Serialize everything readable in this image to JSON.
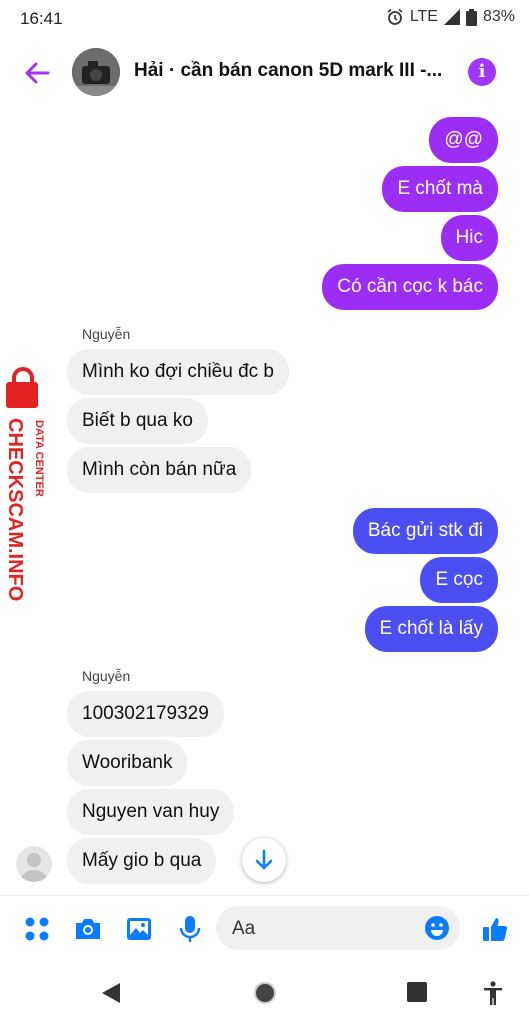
{
  "status": {
    "time": "16:41",
    "network": "LTE",
    "battery": "83%"
  },
  "header": {
    "title": "Hải · cần bán canon 5D mark III -..."
  },
  "watermark": {
    "brand": "CHECKSCAM.INFO",
    "sub": "DATA CENTER"
  },
  "messages": {
    "out1": [
      "@@",
      "E chốt mà",
      "Hic",
      "Có cần cọc k bác"
    ],
    "sender1": "Nguyễn",
    "in1": [
      "Mình ko đợi chiều đc b",
      "Biết b qua ko",
      "Mình còn bán nữa"
    ],
    "out2": [
      "Bác gửi stk đi",
      "E cọc",
      "E chốt là lấy"
    ],
    "sender2": "Nguyễn",
    "in2": [
      "100302179329",
      "Wooribank",
      "Nguyen van huy",
      "Mấy gio b qua"
    ]
  },
  "composer": {
    "placeholder": "Aa"
  },
  "colors": {
    "purple": "#9b2df5",
    "blue": "#4b4ef0",
    "accent": "#a334fa",
    "icon": "#0a7cff"
  }
}
